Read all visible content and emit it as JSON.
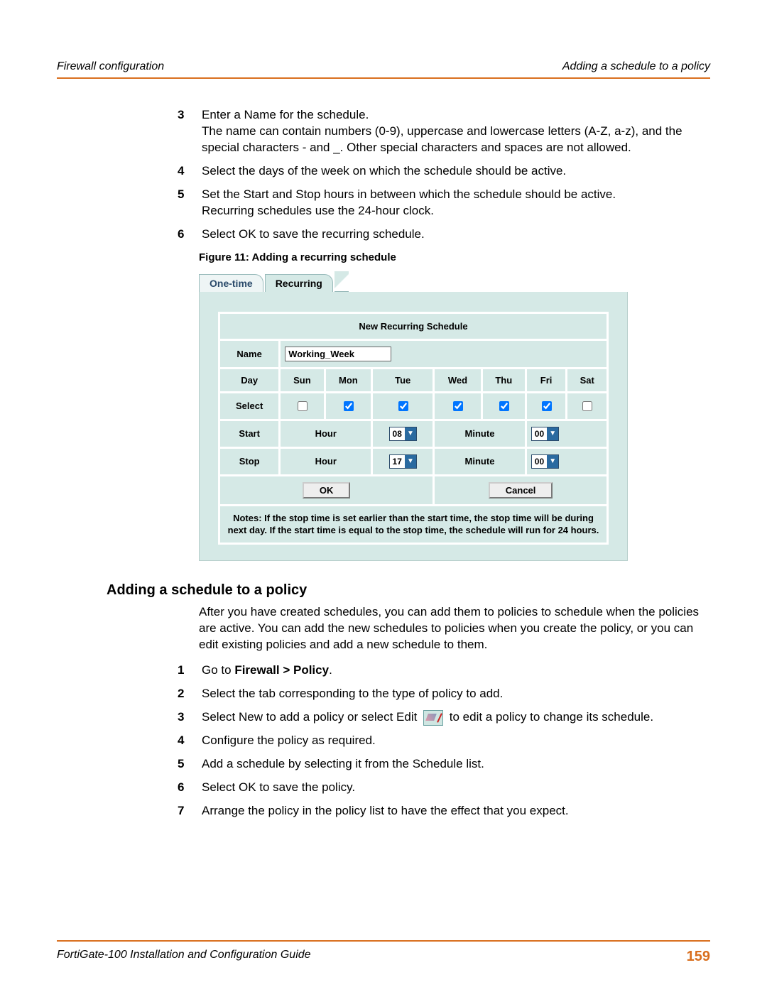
{
  "header": {
    "left": "Firewall configuration",
    "right": "Adding a schedule to a policy"
  },
  "stepsA": [
    {
      "n": "3",
      "text": "Enter a Name for the schedule.",
      "sub": "The name can contain numbers (0-9), uppercase and lowercase letters (A-Z, a-z), and the special characters - and _. Other special characters and spaces are not allowed."
    },
    {
      "n": "4",
      "text": "Select the days of the week on which the schedule should be active."
    },
    {
      "n": "5",
      "text": "Set the Start and Stop hours in between which the schedule should be active.",
      "sub": "Recurring schedules use the 24-hour clock."
    },
    {
      "n": "6",
      "text": "Select OK to save the recurring schedule."
    }
  ],
  "figureCaption": "Figure 11: Adding a recurring schedule",
  "figure": {
    "tabInactive": "One-time",
    "tabActive": "Recurring",
    "title": "New Recurring Schedule",
    "nameLabel": "Name",
    "nameValue": "Working_Week",
    "dayLabel": "Day",
    "days": [
      "Sun",
      "Mon",
      "Tue",
      "Wed",
      "Thu",
      "Fri",
      "Sat"
    ],
    "selectLabel": "Select",
    "selected": [
      false,
      true,
      true,
      true,
      true,
      true,
      false
    ],
    "startLabel": "Start",
    "stopLabel": "Stop",
    "hourLabel": "Hour",
    "minuteLabel": "Minute",
    "startHour": "08",
    "startMinute": "00",
    "stopHour": "17",
    "stopMinute": "00",
    "okLabel": "OK",
    "cancelLabel": "Cancel",
    "notes": "Notes: If the stop time is set earlier than the start time, the stop time will be during next day. If the start time is equal to the stop time, the schedule will run for 24 hours."
  },
  "sectionTitle": "Adding a schedule to a policy",
  "sectionIntro": "After you have created schedules, you can add them to policies to schedule when the policies are active. You can add the new schedules to policies when you create the policy, or you can edit existing policies and add a new schedule to them.",
  "stepsB": [
    {
      "n": "1",
      "pre": "Go to ",
      "bold": "Firewall > Policy",
      "post": "."
    },
    {
      "n": "2",
      "text": "Select the tab corresponding to the type of policy to add."
    },
    {
      "n": "3",
      "pre": "Select New to add a policy or select Edit ",
      "icon": true,
      "post": " to edit a policy to change its schedule."
    },
    {
      "n": "4",
      "text": "Configure the policy as required."
    },
    {
      "n": "5",
      "text": "Add a schedule by selecting it from the Schedule list."
    },
    {
      "n": "6",
      "text": "Select OK to save the policy."
    },
    {
      "n": "7",
      "text": "Arrange the policy in the policy list to have the effect that you expect."
    }
  ],
  "footer": {
    "title": "FortiGate-100 Installation and Configuration Guide",
    "page": "159"
  }
}
